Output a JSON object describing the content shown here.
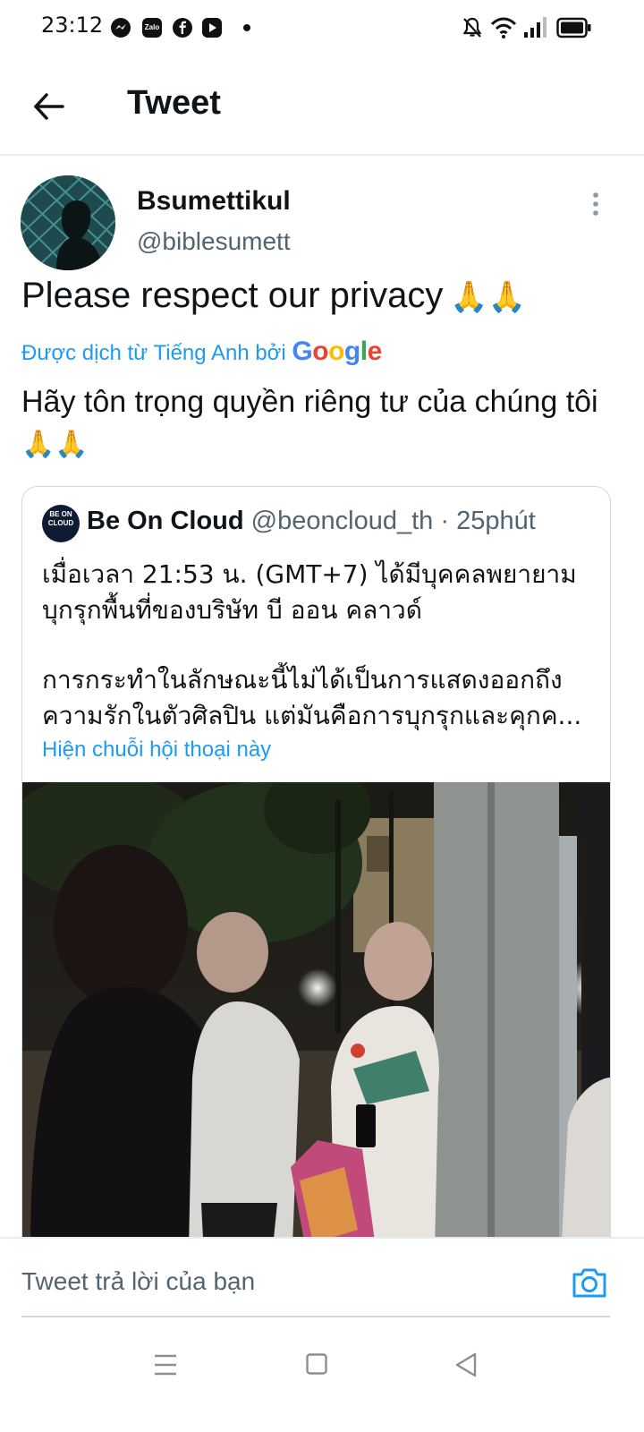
{
  "status_bar": {
    "time": "23:12",
    "app_icons": [
      "messenger-icon",
      "zalo-icon",
      "facebook-icon",
      "youtube-icon"
    ],
    "zalo_label": "Zalo",
    "system_icons": [
      "mute-icon",
      "wifi-icon",
      "signal-icon",
      "battery-icon"
    ]
  },
  "header": {
    "title": "Tweet",
    "back_icon": "back-arrow-icon"
  },
  "tweet": {
    "author_name": "Bsumettikul",
    "author_handle": "@biblesumett",
    "text": "Please respect our privacy",
    "emoji": "🙏🙏",
    "translated_label": "Được dịch từ Tiếng Anh bởi",
    "translator_logo": "Google",
    "translated_text": "Hãy tôn trọng quyền riêng tư của chúng tôi"
  },
  "quoted_tweet": {
    "avatar_text": "BE ON CLOUD",
    "name": "Be On Cloud",
    "handle": "@beoncloud_th",
    "separator": "·",
    "time": "25phút",
    "text_p1": "เมื่อเวลา 21:53 น. (GMT+7) ได้มีบุคคลพยายามบุกรุกพื้นที่ของบริษัท บี ออน คลาวด์",
    "text_p2": "การกระทำในลักษณะนี้ไม่ได้เป็นการแสดงออกถึงความรักในตัวศิลปิน แต่มันคือการบุกรุกและคุกค...",
    "show_thread": "Hiện chuỗi hội thoại này",
    "photo": "night-street-photo"
  },
  "reply_bar": {
    "placeholder": "Tweet trả lời của bạn",
    "camera_icon": "camera-icon"
  },
  "colors": {
    "accent": "#1d9bf0",
    "text": "#0f1419",
    "secondary": "#536471",
    "border": "#cfd9de"
  },
  "nav_bar": [
    "menu-icon",
    "home-square-icon",
    "back-triangle-icon"
  ]
}
